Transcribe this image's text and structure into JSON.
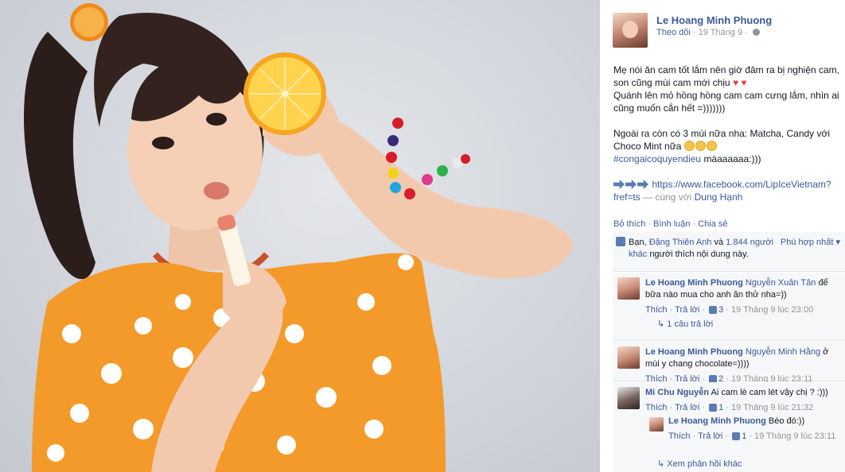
{
  "photo": {
    "background": "#d6d9de",
    "shirt_color": "#f49a2a"
  },
  "post": {
    "author": "Le Hoang Minh Phuong",
    "follow_label": "Theo dõi",
    "date": "19 Tháng 9",
    "privacy_icon": "globe-icon",
    "lines": [
      "Mẹ nói ăn cam tốt lắm nên giờ đâm ra bị nghiện cam,",
      "son cũng mùi cam mới chịu",
      "Quánh lên mỏ hồng hồng cam cam cưng lắm, nhìn ai",
      "cũng muốn cắn hết =)))))))",
      "Ngoài ra còn có 3 mùi nữa nha: Matcha, Candy với",
      "Choco Mint nữa",
      "#congaicoquyendieu",
      "màaaaaaa:)))",
      "https://www.facebook.com/LipIceVietnam?",
      "fref=ts",
      "— cùng với",
      "Dung Hạnh"
    ]
  },
  "actions": {
    "like": "Bỏ thích",
    "comment": "Bình luận",
    "share": "Chia sẻ"
  },
  "likes": {
    "prefix": "Bạn,",
    "name": "Đặng Thiên Anh",
    "and": "và",
    "others": "1.844 người khác",
    "suffix": "người thích nội dung này.",
    "sort": "Phù hợp nhất"
  },
  "comments": [
    {
      "author": "Le Hoang Minh Phuong",
      "mention": "Nguyễn Xuân Tân",
      "text": "để bữa nào mua cho anh ăn thử nha=))",
      "like": "Thích",
      "reply": "Trả lời",
      "count": "3",
      "time": "19 Tháng 9 lúc 23:00",
      "replies": "1 câu trả lời"
    },
    {
      "author": "Le Hoang Minh Phuong",
      "mention": "Nguyễn Minh Hằng",
      "text": "ở mùi y chang chocolate=))))",
      "like": "Thích",
      "reply": "Trả lời",
      "count": "2",
      "time": "19 Tháng 9 lúc 23:11"
    },
    {
      "author": "Mi Chu Nguyễn",
      "text": "Ai cam lè cam lét vậy chị ? :)))",
      "like": "Thích",
      "reply": "Trả lời",
      "count": "1",
      "time": "19 Tháng 9 lúc 21:32"
    }
  ],
  "reply": {
    "author": "Le Hoang Minh Phuong",
    "text": "Bèo đó:))",
    "like": "Thích",
    "reply": "Trả lời",
    "count": "1",
    "time": "19 Tháng 9 lúc 23:11",
    "more": "Xem phản hồi khác"
  }
}
